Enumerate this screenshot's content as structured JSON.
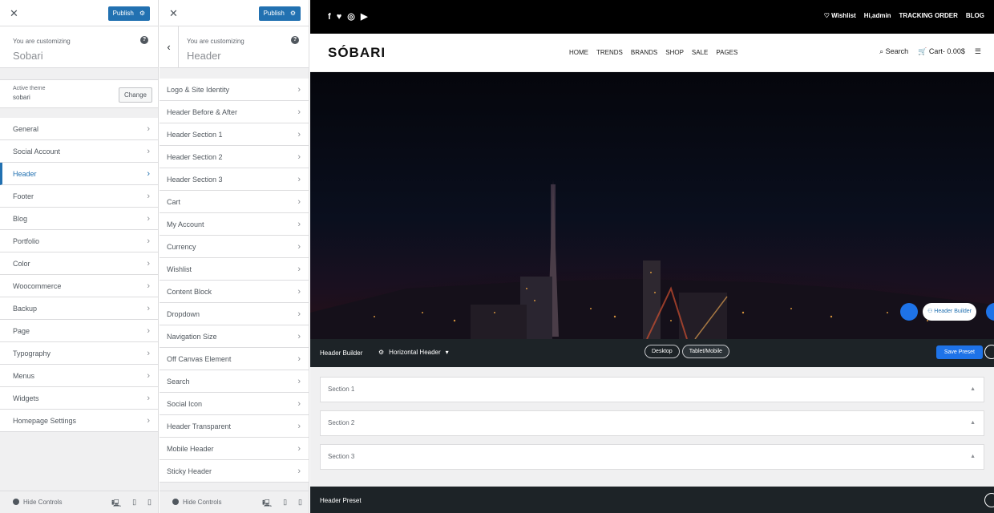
{
  "panel1": {
    "close": "✕",
    "publish": "Publish",
    "customizing": "You are customizing",
    "site_name": "Sobari",
    "active_theme_label": "Active theme",
    "theme_name": "sobari",
    "change": "Change",
    "items": [
      "General",
      "Social Account",
      "Header",
      "Footer",
      "Blog",
      "Portfolio",
      "Color",
      "Woocommerce",
      "Backup",
      "Page",
      "Typography",
      "Menus",
      "Widgets",
      "Homepage Settings"
    ],
    "active_item": "Header",
    "hide": "Hide Controls"
  },
  "panel2": {
    "close": "✕",
    "publish": "Publish",
    "customizing": "You are customizing",
    "section": "Header",
    "items": [
      "Logo & Site Identity",
      "Header Before & After",
      "Header Section 1",
      "Header Section 2",
      "Header Section 3",
      "Cart",
      "My Account",
      "Currency",
      "Wishlist",
      "Content Block",
      "Dropdown",
      "Navigation Size",
      "Off Canvas Element",
      "Search",
      "Social Icon",
      "Header Transparent",
      "Mobile Header",
      "Sticky Header"
    ],
    "hide": "Hide Controls"
  },
  "site": {
    "social": "f ♥ ◎ ▶",
    "wishlist": "Wishlist",
    "user": "Hi,admin",
    "tracking": "TRACKING ORDER",
    "blog": "BLOG",
    "logo": "SÓBARI",
    "nav": [
      "HOME",
      "TRENDS",
      "BRANDS",
      "SHOP",
      "SALE",
      "PAGES"
    ],
    "search": "Search",
    "cart": "Cart- 0.00$"
  },
  "builder": {
    "title": "Header Builder",
    "type": "Horizontal Header",
    "desktop": "Desktop",
    "tablet": "Tablet/Mobile",
    "save": "Save Preset",
    "float_label": "Header Builder",
    "sections": [
      "Section 1",
      "Section 2",
      "Section 3"
    ],
    "preset": "Header Preset"
  }
}
